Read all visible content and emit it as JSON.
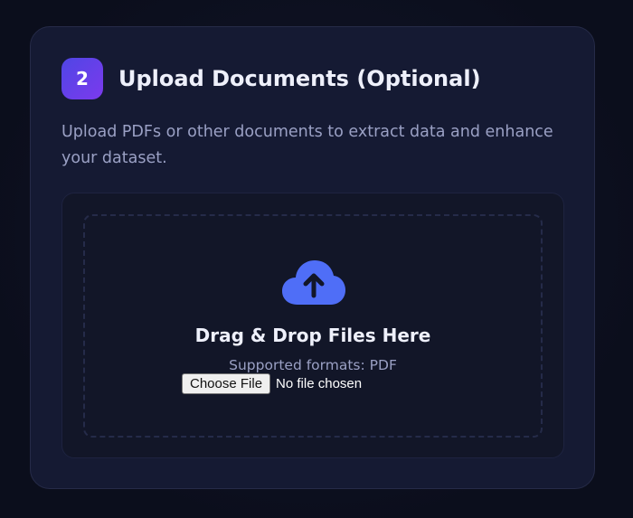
{
  "card": {
    "step_number": "2",
    "title": "Upload Documents (Optional)",
    "description": "Upload PDFs or other documents to extract data and enhance your dataset."
  },
  "upload": {
    "icon": "cloud-upload-icon",
    "drop_title": "Drag & Drop Files Here",
    "supported_formats": "Supported formats: PDF",
    "choose_file_label": "Choose File",
    "file_status": "No file chosen"
  },
  "colors": {
    "accent": "#4f6ef7",
    "badge_start": "#4f46e5",
    "badge_end": "#7c3aed",
    "card_bg": "#151a33",
    "page_bg": "#0b0e1c"
  }
}
